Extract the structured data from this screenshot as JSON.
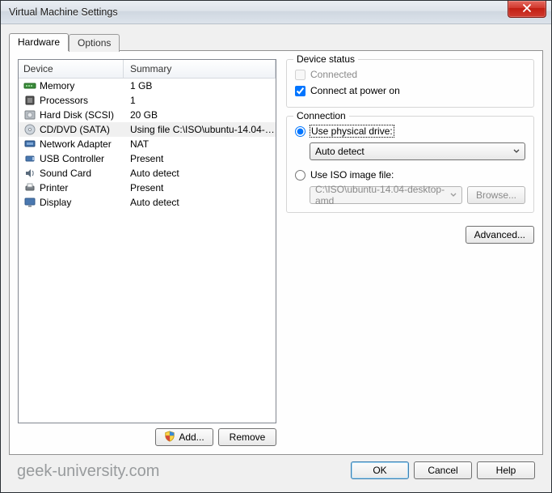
{
  "window": {
    "title": "Virtual Machine Settings"
  },
  "tabs": {
    "hardware": "Hardware",
    "options": "Options"
  },
  "table": {
    "col_device": "Device",
    "col_summary": "Summary"
  },
  "devices": [
    {
      "name": "Memory",
      "summary": "1 GB"
    },
    {
      "name": "Processors",
      "summary": "1"
    },
    {
      "name": "Hard Disk (SCSI)",
      "summary": "20 GB"
    },
    {
      "name": "CD/DVD (SATA)",
      "summary": "Using file C:\\ISO\\ubuntu-14.04-d..."
    },
    {
      "name": "Network Adapter",
      "summary": "NAT"
    },
    {
      "name": "USB Controller",
      "summary": "Present"
    },
    {
      "name": "Sound Card",
      "summary": "Auto detect"
    },
    {
      "name": "Printer",
      "summary": "Present"
    },
    {
      "name": "Display",
      "summary": "Auto detect"
    }
  ],
  "left_buttons": {
    "add": "Add...",
    "remove": "Remove"
  },
  "status_group": {
    "legend": "Device status",
    "connected": "Connected",
    "connect_power_on": "Connect at power on"
  },
  "connection_group": {
    "legend": "Connection",
    "use_physical": "Use physical drive:",
    "physical_value": "Auto detect",
    "use_iso": "Use ISO image file:",
    "iso_value": "C:\\ISO\\ubuntu-14.04-desktop-amd",
    "browse": "Browse..."
  },
  "advanced": "Advanced...",
  "bottom": {
    "ok": "OK",
    "cancel": "Cancel",
    "help": "Help"
  },
  "watermark": "geek-university.com"
}
